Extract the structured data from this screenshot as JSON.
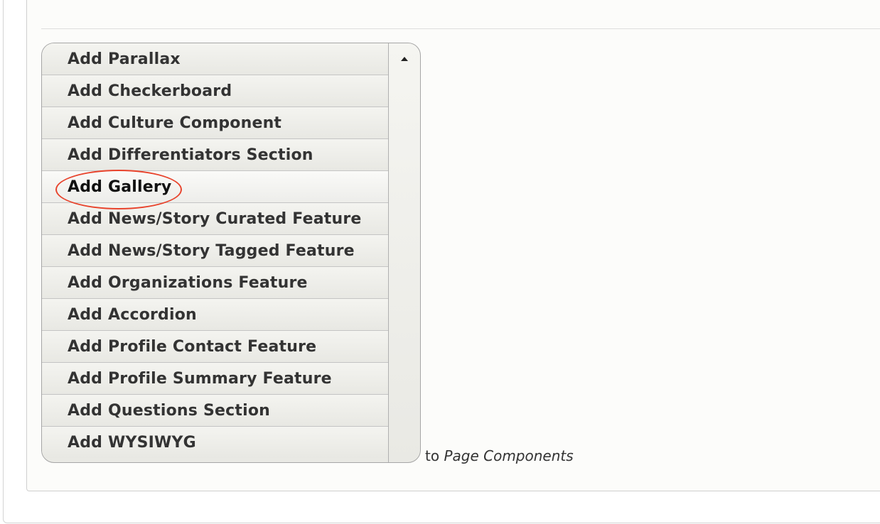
{
  "dropbutton": {
    "items": [
      {
        "label": "Add Parallax"
      },
      {
        "label": "Add Checkerboard"
      },
      {
        "label": "Add Culture Component"
      },
      {
        "label": "Add Differentiators Section"
      },
      {
        "label": "Add Gallery",
        "highlighted": true
      },
      {
        "label": "Add News/Story Curated Feature"
      },
      {
        "label": "Add News/Story Tagged Feature"
      },
      {
        "label": "Add Organizations Feature"
      },
      {
        "label": "Add Accordion"
      },
      {
        "label": "Add Profile Contact Feature"
      },
      {
        "label": "Add Profile Summary Feature"
      },
      {
        "label": "Add Questions Section"
      },
      {
        "label": "Add WYSIWYG"
      }
    ],
    "toggle_icon": "arrow-up-icon"
  },
  "target": {
    "prefix": "to",
    "name": "Page Components"
  },
  "colors": {
    "annotation": "#e8432c",
    "text": "#333333",
    "border": "#a6a6a6"
  }
}
